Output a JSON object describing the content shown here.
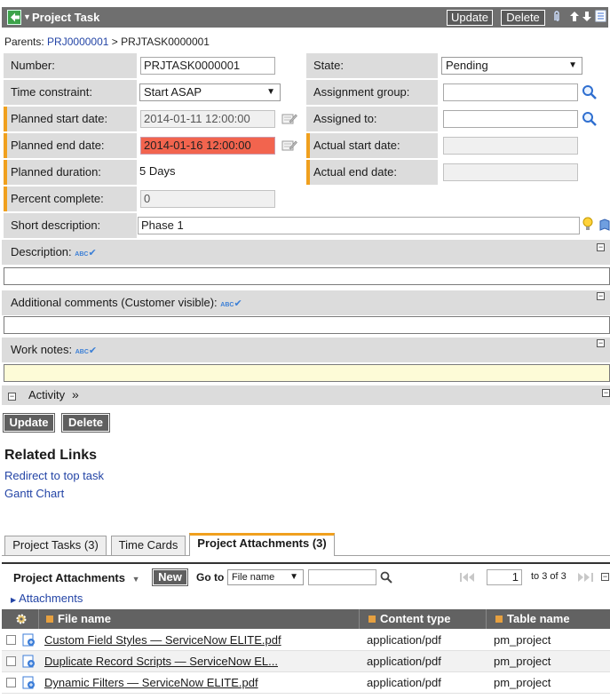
{
  "header": {
    "title": "Project Task",
    "update_label": "Update",
    "delete_label": "Delete"
  },
  "breadcrumb": {
    "prefix": "Parents:",
    "parent": "PRJ0000001",
    "separator": ">",
    "current": "PRJTASK0000001"
  },
  "form": {
    "number_label": "Number:",
    "number_value": "PRJTASK0000001",
    "state_label": "State:",
    "state_value": "Pending",
    "time_constraint_label": "Time constraint:",
    "time_constraint_value": "Start ASAP",
    "assignment_group_label": "Assignment group:",
    "assignment_group_value": "",
    "planned_start_label": "Planned start date:",
    "planned_start_value": "2014-01-11 12:00:00",
    "assigned_to_label": "Assigned to:",
    "assigned_to_value": "",
    "planned_end_label": "Planned end date:",
    "planned_end_value": "2014-01-16 12:00:00",
    "actual_start_label": "Actual start date:",
    "actual_start_value": "",
    "planned_duration_label": "Planned duration:",
    "planned_duration_value": "5 Days",
    "actual_end_label": "Actual end date:",
    "actual_end_value": "",
    "percent_label": "Percent complete:",
    "percent_value": "0",
    "short_desc_label": "Short description:",
    "short_desc_value": "Phase 1"
  },
  "sections": {
    "description": "Description:",
    "additional_comments": "Additional comments (Customer visible):",
    "work_notes": "Work notes:",
    "spell_badge": "ABC",
    "activity": "Activity",
    "activity_arrows": "»"
  },
  "footer_buttons": {
    "update_label": "Update",
    "delete_label": "Delete"
  },
  "related_links": {
    "title": "Related Links",
    "items": [
      "Redirect to top task",
      "Gantt Chart"
    ]
  },
  "tabs": [
    {
      "label": "Project Tasks (3)",
      "active": false
    },
    {
      "label": "Time Cards",
      "active": false
    },
    {
      "label": "Project Attachments (3)",
      "active": true
    }
  ],
  "list": {
    "title": "Project Attachments",
    "new_label": "New",
    "goto_label": "Go to",
    "goto_field": "File name",
    "goto_value": "",
    "page_value": "1",
    "range_text": "to 3 of 3",
    "filter_link": "Attachments",
    "columns": [
      "File name",
      "Content type",
      "Table name"
    ],
    "rows": [
      {
        "file": "Custom Field Styles — ServiceNow ELITE.pdf",
        "type": "application/pdf",
        "table": "pm_project"
      },
      {
        "file": "Duplicate Record Scripts — ServiceNow EL...",
        "type": "application/pdf",
        "table": "pm_project"
      },
      {
        "file": "Dynamic Filters — ServiceNow ELITE.pdf",
        "type": "application/pdf",
        "table": "pm_project"
      }
    ]
  },
  "colors": {
    "header_bg": "#6f6f6f",
    "label_bg": "#dcdcdc",
    "mandatory": "#f0a01e",
    "error_field": "#f2644e",
    "link": "#2445a6",
    "notes_bg": "#fdfbd7"
  },
  "icons": [
    "back-arrow-icon",
    "context-menu-icon",
    "paperclip-icon",
    "up-arrow-icon",
    "down-arrow-icon",
    "list-icon",
    "calendar-icon",
    "magnifier-icon",
    "lightbulb-icon",
    "book-icon",
    "spellcheck-icon",
    "collapse-icon",
    "gear-icon",
    "file-icon",
    "first-page-icon",
    "prev-page-icon",
    "next-page-icon",
    "last-page-icon"
  ]
}
